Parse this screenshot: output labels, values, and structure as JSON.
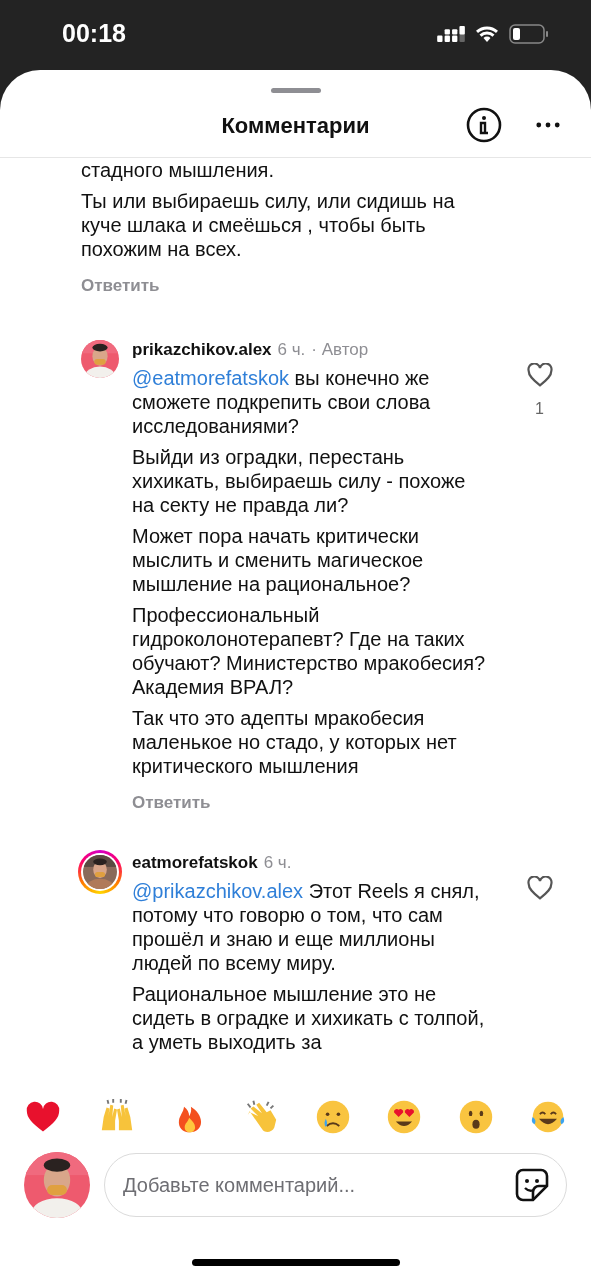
{
  "status_bar": {
    "time": "00:18"
  },
  "sheet": {
    "title": "Комментарии"
  },
  "comments": [
    {
      "kind": "partial",
      "paragraphs": [
        "стадного мышления.",
        "Ты или выбираешь силу, или сидишь на куче шлака и смеёшься , чтобы быть похожим на всех."
      ],
      "reply": "Ответить"
    },
    {
      "kind": "full",
      "username": "prikazchikov.alex",
      "time": "6 ч.",
      "badge": "· Автор",
      "story_ring": false,
      "mention": "@eatmorefatskok",
      "paragraphs": [
        "вы конечно же сможете подкрепить свои слова исследованиями?",
        "Выйди из оградки, перестань хихикать, выбираешь силу - похоже на секту не правда ли?",
        "Может пора начать критически мыслить и сменить магическое мышление на рациональное?",
        "Профессиональный гидроколонотерапевт? Где на таких обучают? Министерство мракобесия? Академия ВРАЛ?",
        "Так что это адепты мракобесия маленькое но стадо, у которых нет критического мышления"
      ],
      "liked": false,
      "likes": "1",
      "reply": "Ответить"
    },
    {
      "kind": "full",
      "username": "eatmorefatskok",
      "time": "6 ч.",
      "story_ring": true,
      "mention": "@prikazchikov.alex",
      "paragraphs": [
        "Этот Reels я снял, потому что говорю о том, что сам прошёл и знаю и еще миллионы людей по всему миру.",
        "Рациональное мышление это не сидеть в оградке и хихикать с толпой, а уметь выходить за"
      ],
      "liked": false
    }
  ],
  "composer": {
    "placeholder": "Добавьте комментарий..."
  }
}
